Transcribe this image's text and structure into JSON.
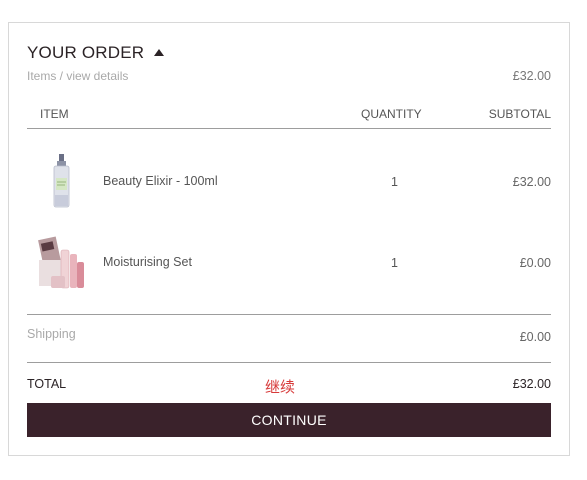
{
  "order": {
    "title": "YOUR ORDER",
    "items_link": "Items / view details",
    "items_total": "£32.00"
  },
  "table": {
    "headers": {
      "item": "ITEM",
      "quantity": "QUANTITY",
      "subtotal": "SUBTOTAL"
    },
    "rows": [
      {
        "name": "Beauty Elixir - 100ml",
        "quantity": "1",
        "subtotal": "£32.00",
        "icon": "bottle-product-image"
      },
      {
        "name": "Moisturising Set",
        "quantity": "1",
        "subtotal": "£0.00",
        "icon": "gift-set-product-image"
      }
    ]
  },
  "shipping": {
    "label": "Shipping",
    "value": "£0.00"
  },
  "total": {
    "label": "TOTAL",
    "note": "继续",
    "value": "£32.00"
  },
  "continue_label": "CONTINUE",
  "colors": {
    "button": "#3a222b",
    "note": "#d73a3a"
  }
}
